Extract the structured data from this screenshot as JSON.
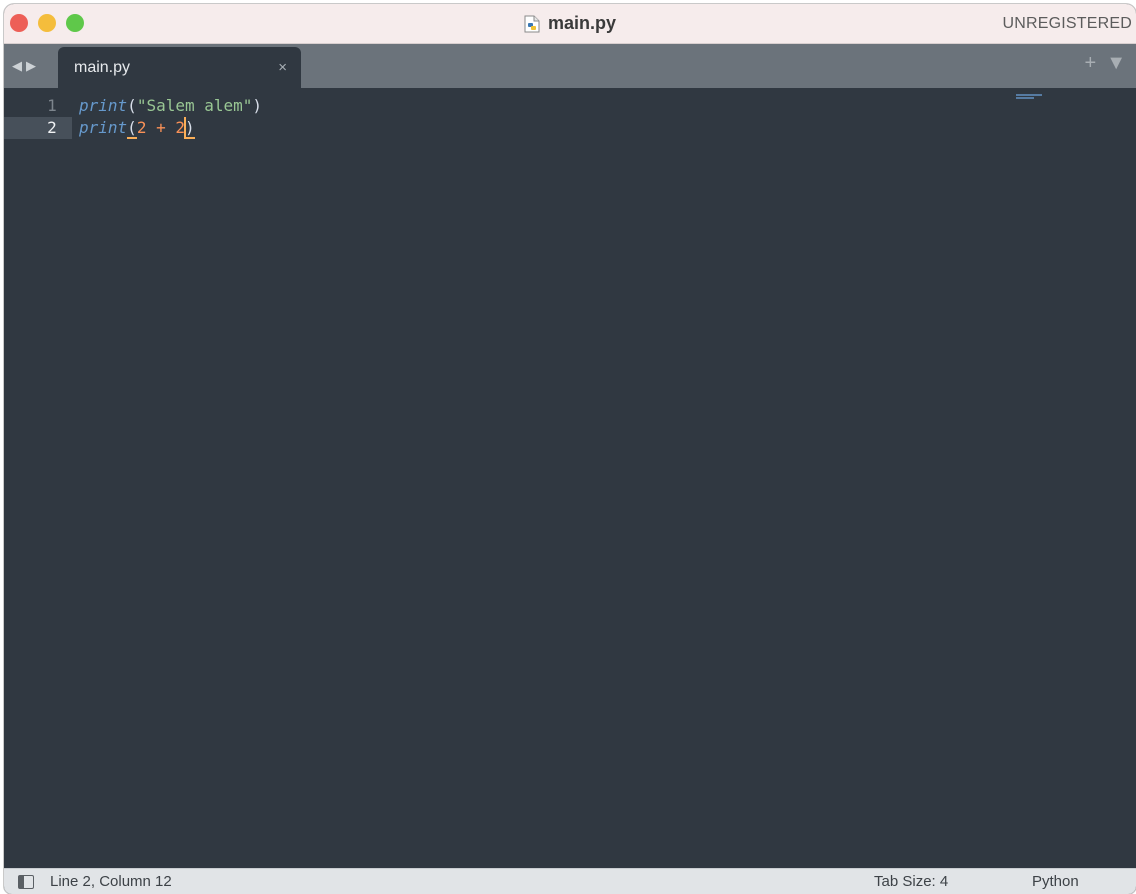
{
  "window": {
    "title": "main.py",
    "license_label": "UNREGISTERED"
  },
  "tabbar": {
    "nav_back_icon": "triangle-left-icon",
    "nav_forward_icon": "triangle-right-icon",
    "active_tab": {
      "label": "main.py",
      "close_glyph": "×"
    },
    "new_tab_glyph": "+",
    "menu_glyph": "▼"
  },
  "editor": {
    "lines": [
      {
        "number": "1",
        "tokens": {
          "fn": "print",
          "open": "(",
          "string": "\"Salem alem\"",
          "close": ")"
        }
      },
      {
        "number": "2",
        "tokens": {
          "fn": "print",
          "open": "(",
          "num1": "2",
          "op": " + ",
          "num2": "2",
          "close": ")"
        }
      }
    ],
    "current_line": 2
  },
  "statusbar": {
    "position": "Line 2, Column 12",
    "tab_size": "Tab Size: 4",
    "syntax": "Python"
  },
  "colors": {
    "editor_bg": "#303841",
    "keyword": "#6699cc",
    "string": "#99c794",
    "number": "#f99157",
    "caret": "#f9ae58"
  }
}
